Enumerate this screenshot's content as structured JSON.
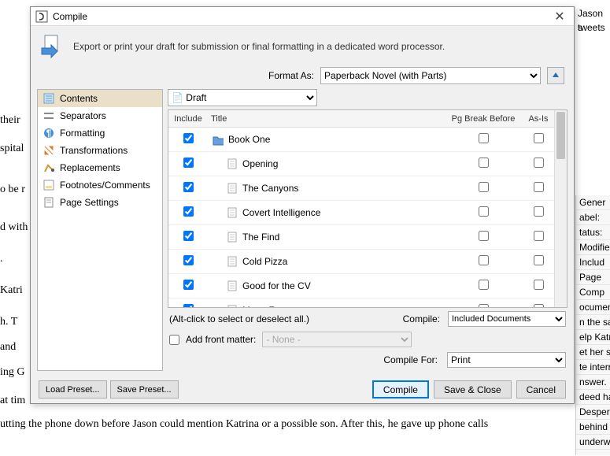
{
  "background": {
    "lines": [
      "their",
      "spital",
      "o be r",
      "d with",
      ".",
      "Katri",
      "h. T",
      "and",
      "ing G",
      "at tim"
    ],
    "bottom": "utting the phone down before Jason could mention Katrina or a possible son. After this, he gave up phone calls",
    "top_right": [
      "Jason s",
      "tweets"
    ],
    "right_panel": [
      "Gener",
      "abel:",
      "tatus:",
      "Modified:",
      "Includ",
      "Page",
      "Comp",
      "ocumen",
      "n the sar",
      "elp Katr",
      "et her s",
      "te interr",
      "nswer.",
      "deed ha",
      "Desperat",
      "behind Li",
      "underwe"
    ]
  },
  "dialog": {
    "title": "Compile",
    "description": "Export or print your draft for submission or final formatting in a dedicated word processor.",
    "format_label": "Format As:",
    "format_value": "Paperback Novel (with Parts)",
    "nav": [
      {
        "icon": "contents",
        "label": "Contents",
        "selected": true
      },
      {
        "icon": "separators",
        "label": "Separators"
      },
      {
        "icon": "formatting",
        "label": "Formatting"
      },
      {
        "icon": "transformations",
        "label": "Transformations"
      },
      {
        "icon": "replacements",
        "label": "Replacements"
      },
      {
        "icon": "footnotes",
        "label": "Footnotes/Comments"
      },
      {
        "icon": "page",
        "label": "Page Settings"
      }
    ],
    "draft_select": "Draft",
    "columns": {
      "include": "Include",
      "title": "Title",
      "pgb": "Pg Break Before",
      "asis": "As-Is"
    },
    "rows": [
      {
        "indent": 0,
        "type": "folder",
        "title": "Book One",
        "include": true,
        "pgb": false,
        "asis": false
      },
      {
        "indent": 1,
        "type": "doc",
        "title": "Opening",
        "include": true,
        "pgb": false,
        "asis": false
      },
      {
        "indent": 1,
        "type": "doc",
        "title": "The Canyons",
        "include": true,
        "pgb": false,
        "asis": false
      },
      {
        "indent": 1,
        "type": "doc",
        "title": "Covert Intelligence",
        "include": true,
        "pgb": false,
        "asis": false
      },
      {
        "indent": 1,
        "type": "doc",
        "title": "The Find",
        "include": true,
        "pgb": false,
        "asis": false
      },
      {
        "indent": 1,
        "type": "doc",
        "title": "Cold Pizza",
        "include": true,
        "pgb": false,
        "asis": false
      },
      {
        "indent": 1,
        "type": "doc",
        "title": "Good for the CV",
        "include": true,
        "pgb": false,
        "asis": false
      },
      {
        "indent": 1,
        "type": "doc",
        "title": "Moon Face",
        "include": true,
        "pgb": false,
        "asis": false
      }
    ],
    "hint": "(Alt-click to select or deselect all.)",
    "compile_scope_label": "Compile:",
    "compile_scope": "Included Documents",
    "front_matter_label": "Add front matter:",
    "front_matter_value": "- None -",
    "compile_for_label": "Compile For:",
    "compile_for_value": "Print",
    "buttons": {
      "load_preset": "Load Preset...",
      "save_preset": "Save Preset...",
      "compile": "Compile",
      "save_close": "Save & Close",
      "cancel": "Cancel"
    }
  }
}
